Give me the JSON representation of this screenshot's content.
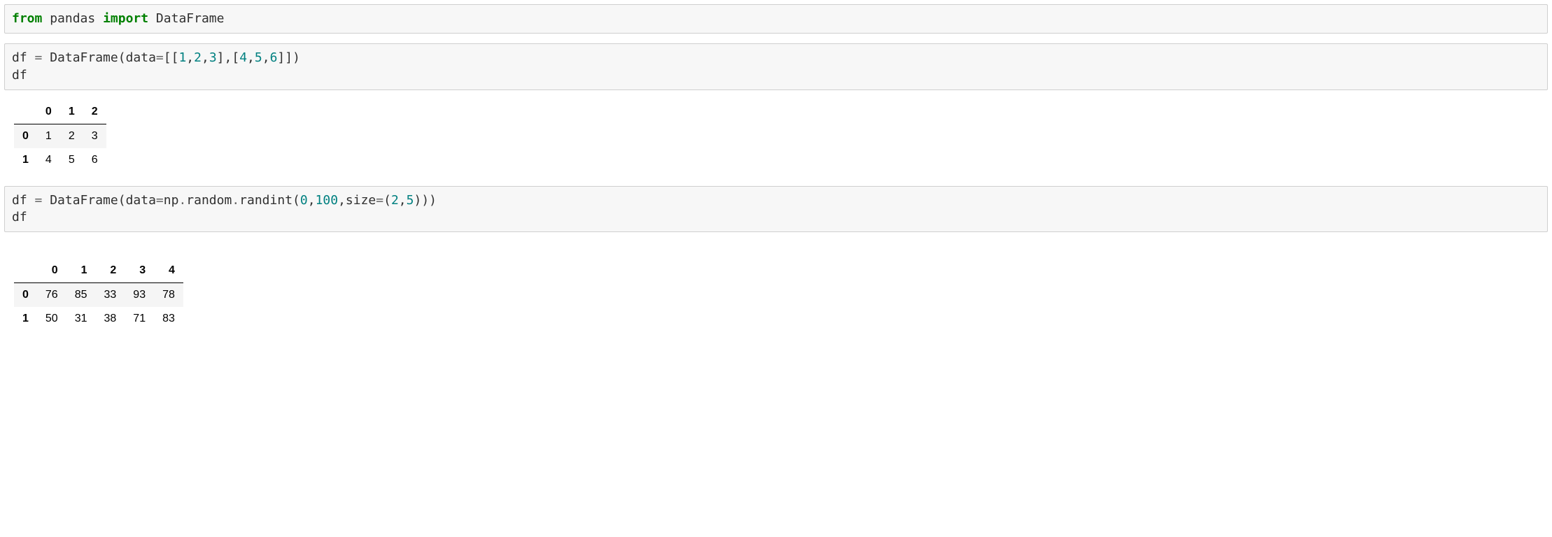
{
  "cells": [
    {
      "type": "code",
      "tokens": [
        {
          "cls": "tok-keyword",
          "text": "from"
        },
        {
          "cls": "",
          "text": " pandas "
        },
        {
          "cls": "tok-keyword",
          "text": "import"
        },
        {
          "cls": "",
          "text": " DataFrame"
        }
      ]
    },
    {
      "type": "code",
      "tokens": [
        {
          "cls": "",
          "text": "df "
        },
        {
          "cls": "tok-operator",
          "text": "="
        },
        {
          "cls": "",
          "text": " DataFrame(data"
        },
        {
          "cls": "tok-operator",
          "text": "="
        },
        {
          "cls": "",
          "text": "[["
        },
        {
          "cls": "tok-number",
          "text": "1"
        },
        {
          "cls": "",
          "text": ","
        },
        {
          "cls": "tok-number",
          "text": "2"
        },
        {
          "cls": "",
          "text": ","
        },
        {
          "cls": "tok-number",
          "text": "3"
        },
        {
          "cls": "",
          "text": "],["
        },
        {
          "cls": "tok-number",
          "text": "4"
        },
        {
          "cls": "",
          "text": ","
        },
        {
          "cls": "tok-number",
          "text": "5"
        },
        {
          "cls": "",
          "text": ","
        },
        {
          "cls": "tok-number",
          "text": "6"
        },
        {
          "cls": "",
          "text": "]])\ndf"
        }
      ]
    },
    {
      "type": "table",
      "columns": [
        "0",
        "1",
        "2"
      ],
      "index": [
        "0",
        "1"
      ],
      "rows": [
        [
          "1",
          "2",
          "3"
        ],
        [
          "4",
          "5",
          "6"
        ]
      ]
    },
    {
      "type": "code",
      "tokens": [
        {
          "cls": "",
          "text": "df "
        },
        {
          "cls": "tok-operator",
          "text": "="
        },
        {
          "cls": "",
          "text": " DataFrame(data"
        },
        {
          "cls": "tok-operator",
          "text": "="
        },
        {
          "cls": "",
          "text": "np"
        },
        {
          "cls": "tok-operator",
          "text": "."
        },
        {
          "cls": "",
          "text": "random"
        },
        {
          "cls": "tok-operator",
          "text": "."
        },
        {
          "cls": "",
          "text": "randint("
        },
        {
          "cls": "tok-number",
          "text": "0"
        },
        {
          "cls": "",
          "text": ","
        },
        {
          "cls": "tok-number",
          "text": "100"
        },
        {
          "cls": "",
          "text": ",size"
        },
        {
          "cls": "tok-operator",
          "text": "="
        },
        {
          "cls": "",
          "text": "("
        },
        {
          "cls": "tok-number",
          "text": "2"
        },
        {
          "cls": "",
          "text": ","
        },
        {
          "cls": "tok-number",
          "text": "5"
        },
        {
          "cls": "",
          "text": ")))\ndf"
        }
      ]
    },
    {
      "type": "gap"
    },
    {
      "type": "table",
      "columns": [
        "0",
        "1",
        "2",
        "3",
        "4"
      ],
      "index": [
        "0",
        "1"
      ],
      "rows": [
        [
          "76",
          "85",
          "33",
          "93",
          "78"
        ],
        [
          "50",
          "31",
          "38",
          "71",
          "83"
        ]
      ]
    }
  ]
}
